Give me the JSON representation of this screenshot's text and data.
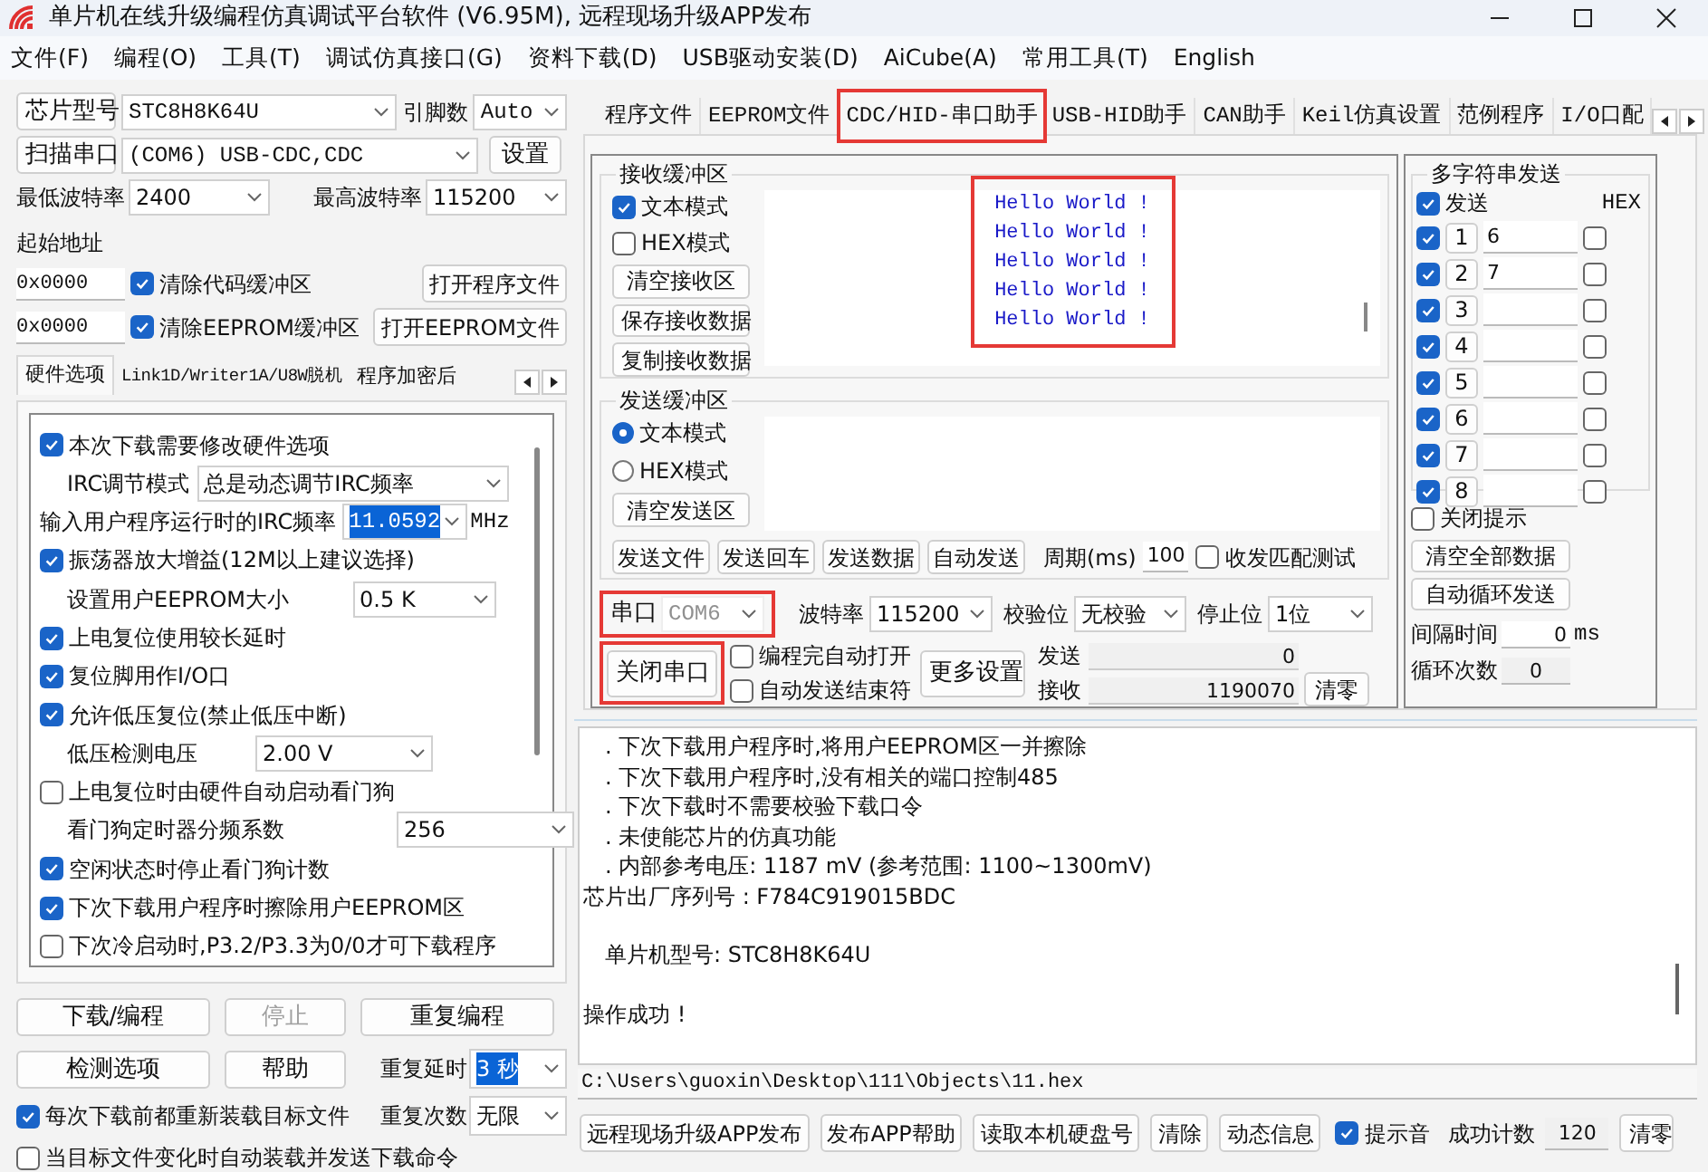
{
  "window": {
    "title": "单片机在线升级编程仿真调试平台软件 (V6.95M), 远程现场升级APP发布"
  },
  "menu": [
    "文件(F)",
    "编程(O)",
    "工具(T)",
    "调试仿真接口(G)",
    "资料下载(D)",
    "USB驱动安装(D)",
    "AiCube(A)",
    "常用工具(T)",
    "English"
  ],
  "left": {
    "chip_button": "芯片型号",
    "chip_model": "STC8H8K64U",
    "pins_label": "引脚数",
    "pins": "Auto",
    "scan_button": "扫描串口",
    "port": "(COM6) USB-CDC,CDC",
    "settings_button": "设置",
    "min_baud_label": "最低波特率",
    "min_baud": "2400",
    "max_baud_label": "最高波特率",
    "max_baud": "115200",
    "start_address_label": "起始地址",
    "address_rows": [
      {
        "address": "0x0000",
        "label": "清除代码缓冲区",
        "checked": true,
        "button": "打开程序文件"
      },
      {
        "address": "0x0000",
        "label": "清除EEPROM缓冲区",
        "checked": true,
        "button": "打开EEPROM文件"
      }
    ],
    "tabs": [
      {
        "label": "硬件选项",
        "selected": true
      },
      {
        "label": "Link1D/Writer1A/U8W脱机",
        "selected": false
      },
      {
        "label": "程序加密后",
        "selected": false
      }
    ],
    "options": [
      {
        "kind": "check",
        "label": "本次下载需要修改硬件选项",
        "checked": true
      },
      {
        "kind": "select",
        "label": "IRC调节模式",
        "value": "总是动态调节IRC频率",
        "value_selected": false
      },
      {
        "kind": "select",
        "label": "输入用户程序运行时的IRC频率",
        "value": "11.0592",
        "unit": "MHz",
        "value_selected": true
      },
      {
        "kind": "check",
        "label": "振荡器放大增益(12M以上建议选择)",
        "checked": true
      },
      {
        "kind": "select",
        "label": "设置用户EEPROM大小",
        "value": "0.5 K",
        "value_selected": false
      },
      {
        "kind": "check",
        "label": "上电复位使用较长延时",
        "checked": true
      },
      {
        "kind": "check",
        "label": "复位脚用作I/O口",
        "checked": true
      },
      {
        "kind": "check",
        "label": "允许低压复位(禁止低压中断)",
        "checked": true
      },
      {
        "kind": "select",
        "label": "低压检测电压",
        "value": "2.00 V",
        "value_selected": false
      },
      {
        "kind": "check",
        "label": "上电复位时由硬件自动启动看门狗",
        "checked": false
      },
      {
        "kind": "select",
        "label": "看门狗定时器分频系数",
        "value": "256",
        "value_selected": false
      },
      {
        "kind": "check",
        "label": "空闲状态时停止看门狗计数",
        "checked": true
      },
      {
        "kind": "check",
        "label": "下次下载用户程序时擦除用户EEPROM区",
        "checked": true
      },
      {
        "kind": "check",
        "label": "下次冷启动时,P3.2/P3.3为0/0才可下载程序",
        "checked": false
      }
    ],
    "download_button": "下载/编程",
    "stop_button": {
      "label": "停止",
      "disabled": true
    },
    "repeat_button": "重复编程",
    "check_button": "检测选项",
    "help_button": "帮助",
    "repeat_delay_label": "重复延时",
    "repeat_delay": "3 秒",
    "repeat_count_label": "重复次数",
    "repeat_count": "无限",
    "reload": {
      "label": "每次下载前都重新装载目标文件",
      "checked": true
    },
    "auto_send": {
      "label": "当目标文件变化时自动装载并发送下载命令",
      "checked": false
    }
  },
  "right": {
    "tabs": [
      {
        "label": "程序文件",
        "selected": false,
        "highlighted": false
      },
      {
        "label": "EEPROM文件",
        "selected": false,
        "highlighted": false
      },
      {
        "label": "CDC/HID-串口助手",
        "selected": true,
        "highlighted": true
      },
      {
        "label": "USB-HID助手",
        "selected": false,
        "highlighted": false
      },
      {
        "label": "CAN助手",
        "selected": false,
        "highlighted": false
      },
      {
        "label": "Keil仿真设置",
        "selected": false,
        "highlighted": false
      },
      {
        "label": "范例程序",
        "selected": false,
        "highlighted": false
      },
      {
        "label": "I/O口配",
        "selected": false,
        "highlighted": false
      }
    ],
    "receive": {
      "title": "接收缓冲区",
      "modes": [
        {
          "label": "文本模式",
          "checked": true
        },
        {
          "label": "HEX模式",
          "checked": false
        }
      ],
      "buttons": [
        "清空接收区",
        "保存接收数据",
        "复制接收数据"
      ],
      "lines": [
        "Hello World !",
        "Hello World !",
        "Hello World !",
        "Hello World !",
        "Hello World !"
      ],
      "highlighted": true
    },
    "send": {
      "title": "发送缓冲区",
      "modes": [
        {
          "label": "文本模式",
          "selected": true
        },
        {
          "label": "HEX模式",
          "selected": false
        }
      ],
      "clear_button": "清空发送区",
      "buttons": [
        "发送文件",
        "发送回车",
        "发送数据",
        "自动发送"
      ],
      "period_label": "周期(ms)",
      "period": "100",
      "match_test": {
        "label": "收发匹配测试",
        "checked": false
      }
    },
    "serial": {
      "port_label": "串口",
      "port": "COM6",
      "highlighted": true,
      "baud_label": "波特率",
      "baud": "115200",
      "parity_label": "校验位",
      "parity": "无校验",
      "stop_label": "停止位",
      "stop": "1位",
      "close_button": "关闭串口",
      "close_highlighted": true,
      "auto_open": {
        "label": "编程完自动打开",
        "checked": false
      },
      "auto_end": {
        "label": "自动发送结束符",
        "checked": false
      },
      "more_button": "更多设置",
      "sent_label": "发送",
      "sent": "0",
      "received_label": "接收",
      "received": "1190070",
      "clear_button": "清零"
    },
    "multi": {
      "title": "多字符串发送",
      "send_all": {
        "label": "发送",
        "checked": true
      },
      "hex_label": "HEX",
      "rows": [
        {
          "send": true,
          "number": "1",
          "value": "6",
          "hex": false
        },
        {
          "send": true,
          "number": "2",
          "value": "7",
          "hex": false
        },
        {
          "send": true,
          "number": "3",
          "hex": false
        },
        {
          "send": true,
          "number": "4",
          "hex": false
        },
        {
          "send": true,
          "number": "5",
          "hex": false
        },
        {
          "send": true,
          "number": "6",
          "hex": false
        },
        {
          "send": true,
          "number": "7",
          "hex": false
        },
        {
          "send": true,
          "number": "8",
          "hex": false
        }
      ],
      "close_hint": {
        "label": "关闭提示",
        "checked": false
      },
      "buttons": [
        "清空全部数据",
        "自动循环发送"
      ],
      "interval_label": "间隔时间",
      "interval": "0",
      "interval_unit": "ms",
      "loop_label": "循环次数",
      "loop": "0"
    },
    "log": [
      {
        "kind": "bullet",
        "text": ". 下次下载用户程序时,将用户EEPROM区一并擦除"
      },
      {
        "kind": "bullet",
        "text": ". 下次下载用户程序时,没有相关的端口控制485"
      },
      {
        "kind": "bullet",
        "text": ". 下次下载时不需要校验下载口令"
      },
      {
        "kind": "bullet",
        "text": ". 未使能芯片的仿真功能"
      },
      {
        "kind": "bullet",
        "text": ". 内部参考电压: 1187 mV (参考范围: 1100~1300mV)"
      },
      {
        "kind": "plain",
        "text": "芯片出厂序列号 : F784C919015BDC"
      },
      {
        "kind": "spaced",
        "text": "单片机型号: STC8H8K64U"
      },
      {
        "kind": "result",
        "text": "操作成功 !"
      }
    ],
    "file_path": "C:\\Users\\guoxin\\Desktop\\111\\Objects\\11.hex",
    "bottom": {
      "buttons": [
        "远程现场升级APP发布",
        "发布APP帮助",
        "读取本机硬盘号",
        "清除",
        "动态信息"
      ],
      "sound": {
        "label": "提示音",
        "checked": true
      },
      "count_label": "成功计数",
      "count": "120",
      "reset_button": "清零"
    }
  }
}
